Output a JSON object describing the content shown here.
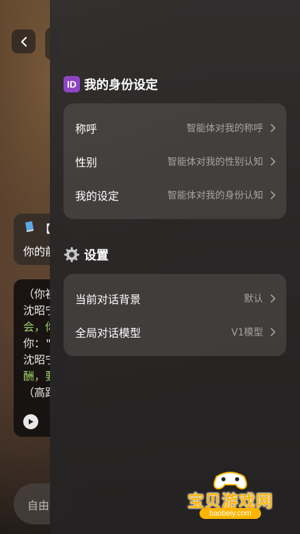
{
  "background": {
    "card_a_line1": "【",
    "card_a_line2": "你的前",
    "card_b_lines": [
      {
        "text": "（你初",
        "green": false
      },
      {
        "text": "沈昭宁",
        "green": false
      },
      {
        "text": "会，你",
        "green": true
      },
      {
        "text": "你：\"",
        "green": false
      },
      {
        "text": "沈昭宁",
        "green": false
      },
      {
        "text": "酬，要",
        "green": true
      },
      {
        "text": "（高跟",
        "green": false
      }
    ],
    "input_placeholder": "自由"
  },
  "identity": {
    "badge": "ID",
    "title": "我的身份设定",
    "rows": [
      {
        "label": "称呼",
        "value": "智能体对我的称呼"
      },
      {
        "label": "性别",
        "value": "智能体对我的性别认知"
      },
      {
        "label": "我的设定",
        "value": "智能体对我的身份认知"
      }
    ]
  },
  "settings": {
    "title": "设置",
    "rows": [
      {
        "label": "当前对话背景",
        "value": "默认"
      },
      {
        "label": "全局对话模型",
        "value": "V1模型"
      }
    ]
  },
  "watermark": {
    "text": "宝贝游戏网",
    "url": "baobeiy.com"
  },
  "colors": {
    "accent_badge": "#8e44c4",
    "watermark": "#ffb400"
  }
}
